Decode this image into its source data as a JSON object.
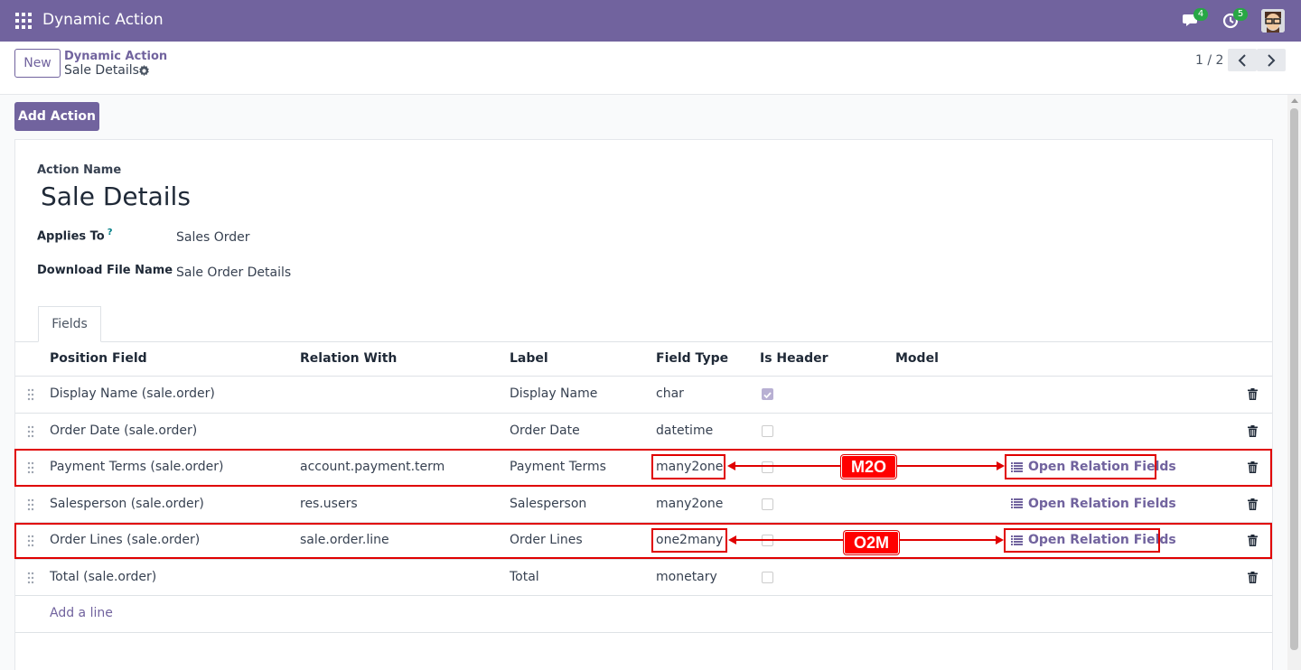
{
  "app": {
    "title": "Dynamic Action",
    "messages_count": "4",
    "activities_count": "5"
  },
  "control_panel": {
    "new_label": "New",
    "breadcrumb_parent": "Dynamic Action",
    "breadcrumb_current": "Sale Details",
    "pager": "1 / 2"
  },
  "add_action_label": "Add Action",
  "form": {
    "action_name_label": "Action Name",
    "action_name": "Sale Details",
    "applies_to_label": "Applies To",
    "applies_to_help": "?",
    "applies_to": "Sales Order",
    "download_label": "Download File Name",
    "download_value": "Sale Order Details",
    "tab_fields": "Fields"
  },
  "table": {
    "headers": [
      "Position Field",
      "Relation With",
      "Label",
      "Field Type",
      "Is Header",
      "Model"
    ],
    "rows": [
      {
        "position": "Display Name (sale.order)",
        "relation": "",
        "label": "Display Name",
        "type": "char",
        "is_header": true,
        "model_action": ""
      },
      {
        "position": "Order Date (sale.order)",
        "relation": "",
        "label": "Order Date",
        "type": "datetime",
        "is_header": false,
        "model_action": ""
      },
      {
        "position": "Payment Terms (sale.order)",
        "relation": "account.payment.term",
        "label": "Payment Terms",
        "type": "many2one",
        "is_header": false,
        "model_action": "Open Relation Fields"
      },
      {
        "position": "Salesperson (sale.order)",
        "relation": "res.users",
        "label": "Salesperson",
        "type": "many2one",
        "is_header": false,
        "model_action": "Open Relation Fields"
      },
      {
        "position": "Order Lines (sale.order)",
        "relation": "sale.order.line",
        "label": "Order Lines",
        "type": "one2many",
        "is_header": false,
        "model_action": "Open Relation Fields"
      },
      {
        "position": "Total (sale.order)",
        "relation": "",
        "label": "Total",
        "type": "monetary",
        "is_header": false,
        "model_action": ""
      }
    ],
    "add_line": "Add a line"
  },
  "annotations": {
    "m2o": "M2O",
    "o2m": "O2M"
  },
  "colors": {
    "brand": "#71639e",
    "annotation": "#ff0000",
    "badge": "#28a745"
  }
}
